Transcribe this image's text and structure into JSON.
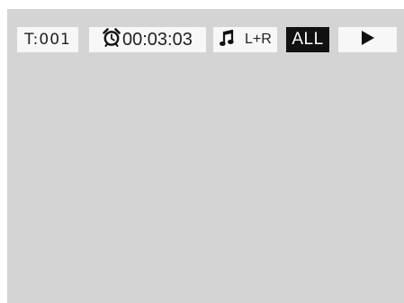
{
  "osd": {
    "track_label": "T:001",
    "elapsed_time": "00:03:03",
    "audio_channel": "L+R",
    "repeat_mode": "ALL",
    "icons": {
      "timer": "alarm-clock-icon",
      "audio": "music-note-icon",
      "playback": "play-icon"
    }
  },
  "colors": {
    "screen_background": "#d4d4d4",
    "box_background": "#f7f7f7",
    "text": "#222222",
    "highlight_background": "#111111",
    "highlight_text": "#ffffff"
  }
}
